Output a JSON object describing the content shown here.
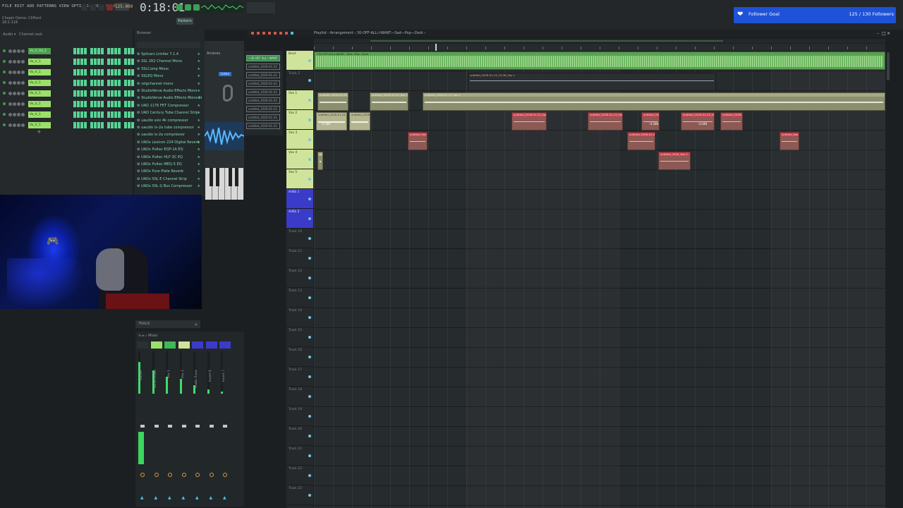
{
  "menu": {
    "items_text": "FILE EDIT ADD PATTERNS VIEW OPTIONS TOOLS HELP"
  },
  "toolbar": {
    "time": "0:18:01",
    "bpm_value": "125.000",
    "mode": "Pattern"
  },
  "song_info": {
    "line1": "Chopin Demo: Clifford",
    "line2": "26:1:116"
  },
  "follower_goal": {
    "label": "Follower Goal",
    "count": "125 / 130 Followers"
  },
  "channel_rack": {
    "channels": [
      {
        "name": "Vo_V_Ad_1",
        "selected": true
      },
      {
        "name": "Vo_V_1",
        "selected": false
      },
      {
        "name": "Vo_V_1",
        "selected": false
      },
      {
        "name": "Vo_V_1",
        "selected": false
      },
      {
        "name": "Vo_V_1",
        "selected": false
      },
      {
        "name": "Vo_V_1",
        "selected": false
      },
      {
        "name": "Vo_V_1",
        "selected": false
      },
      {
        "name": "Vo_V_1",
        "selected": false
      }
    ]
  },
  "browser": {
    "items": [
      "Splicers Limiter 7.1.4",
      "SSL 2R2 Channel Mono",
      "SSLComp Mono",
      "SSLEQ Mono",
      "sslgchannel mono",
      "StudioVerse Audio Effects Mono",
      "StudioVerse Audio Effects Mono-Stereo",
      "UAD 1176 FET Compressor",
      "UAD Century Tube Channel Strip",
      "uaudio sslx 4k compressor",
      "uaudio lx-2a tube compressor",
      "uaudio lx-2a compressor",
      "UADx Lexicon 224 Digital Reverb",
      "UADx Pultec EQP-1A EQ",
      "UADx Pultec HLF-3C EQ",
      "UADx Pultec MEQ-5 EQ",
      "UADx Pure Plate Reverb",
      "UADx SSL E Channel Strip",
      "UADx SSL G Bus Compressor"
    ]
  },
  "plugin_panel": {
    "title": "Antares",
    "button": "Listen"
  },
  "mixer": {
    "search": "TRACK",
    "strips": [
      {
        "label": "Master",
        "color": "#2b3033",
        "level": 0.75
      },
      {
        "label": "Vocal Chain",
        "color": "#9be069",
        "level": 0.55
      },
      {
        "label": "Vox 1",
        "color": "#3fb85a",
        "level": 0.4
      },
      {
        "label": "Vox 2",
        "color": "#cfe39a",
        "level": 0.35
      },
      {
        "label": "Audio Track",
        "color": "#3b3bc9",
        "level": 0.2
      },
      {
        "label": "Insert 6",
        "color": "#3b3bc9",
        "level": 0.1
      },
      {
        "label": "Insert 7",
        "color": "#3b3bc9",
        "level": 0.05
      }
    ]
  },
  "patterns": {
    "items": [
      {
        "name": "~30 OFF ALL I WANT",
        "selected": true
      },
      {
        "name": "untitled_2026-01-23",
        "selected": false
      },
      {
        "name": "untitled_2026-01-23",
        "selected": false
      },
      {
        "name": "untitled_2026-01-23",
        "selected": false
      },
      {
        "name": "untitled_2026-01-23",
        "selected": false
      },
      {
        "name": "untitled_2026-01-23",
        "selected": false
      },
      {
        "name": "untitled_2026-01-23",
        "selected": false
      },
      {
        "name": "untitled_2026-01-23",
        "selected": false
      },
      {
        "name": "untitled_2026-01-23",
        "selected": false
      }
    ]
  },
  "playlist": {
    "title": "Playlist - Arrangement › 30-OFF-ALL-I-WANT—Sad—Pop—Dark ›",
    "tracks": [
      {
        "name": "Beat",
        "style": "audio"
      },
      {
        "name": "Track 2",
        "style": "plain"
      },
      {
        "name": "Vox 1",
        "style": "audio"
      },
      {
        "name": "Vox 2",
        "style": "audio"
      },
      {
        "name": "Vox 3",
        "style": "audio"
      },
      {
        "name": "Vox 4",
        "style": "audio"
      },
      {
        "name": "Vox 5",
        "style": "audio"
      },
      {
        "name": "Adlib 1",
        "style": "blue"
      },
      {
        "name": "Adlib 2",
        "style": "blue"
      },
      {
        "name": "Track 10",
        "style": "plain"
      },
      {
        "name": "Track 11",
        "style": "plain"
      },
      {
        "name": "Track 12",
        "style": "plain"
      },
      {
        "name": "Track 13",
        "style": "plain"
      },
      {
        "name": "Track 14",
        "style": "plain"
      },
      {
        "name": "Track 15",
        "style": "plain"
      },
      {
        "name": "Track 16",
        "style": "plain"
      },
      {
        "name": "Track 17",
        "style": "plain"
      },
      {
        "name": "Track 18",
        "style": "plain"
      },
      {
        "name": "Track 19",
        "style": "plain"
      },
      {
        "name": "Track 20",
        "style": "plain"
      },
      {
        "name": "Track 21",
        "style": "plain"
      },
      {
        "name": "Track 22",
        "style": "plain"
      },
      {
        "name": "Track 23",
        "style": "plain"
      }
    ],
    "clips": [
      {
        "name": "~30-OFF-ALL-I-WANT—Sad—Pop—Dark",
        "style": "mast"
      },
      {
        "name": "untitled_2026-01-23_19-38_Vox 1",
        "style": "dark"
      },
      {
        "name": "untitled_2026-01-23_Vox 1",
        "style": "pale"
      },
      {
        "name": "untitled_2026-01-23_Vox 1",
        "style": "pale"
      },
      {
        "name": "untitled_2026-01-23_Vox 1",
        "style": "pale"
      },
      {
        "name": "untitled_2026-01-23_Vox 1",
        "style": "red"
      },
      {
        "name": "untitled_2026-01-23_Vox 1",
        "style": "red"
      },
      {
        "name": "untitled_2026-01-23_Vox 1",
        "style": "red"
      },
      {
        "name": "untitled_2026-01-23_Vox 2",
        "style": "pale-lt"
      },
      {
        "name": "untitled_2026-01-23_Vox 2",
        "style": "pale-lt"
      },
      {
        "name": "untitled_2026-01-23_Vox 2",
        "style": "red"
      },
      {
        "name": "untitled_2026-01-23_Vox 2",
        "style": "red"
      },
      {
        "name": "untitled_Vox 2",
        "style": "red"
      },
      {
        "name": "untitled_2026-01-23_Vox 2",
        "style": "red"
      },
      {
        "name": "untitled_Vox 2",
        "style": "red"
      },
      {
        "name": "untitled_Vox 3",
        "style": "pale"
      },
      {
        "name": "untitled_2026_Vox 3",
        "style": "red"
      },
      {
        "name": "untitled_Vox 3",
        "style": "red"
      },
      {
        "name": "untitled_2026-01-23_Vox 4",
        "style": "red"
      }
    ],
    "gains": [
      "-4.3dB",
      "-3.0dB",
      "-4.3dB"
    ]
  },
  "colors": {
    "accent_green": "#3fdc6a",
    "follower_blue": "#1e52d8",
    "clip_red": "#d83a4a"
  }
}
